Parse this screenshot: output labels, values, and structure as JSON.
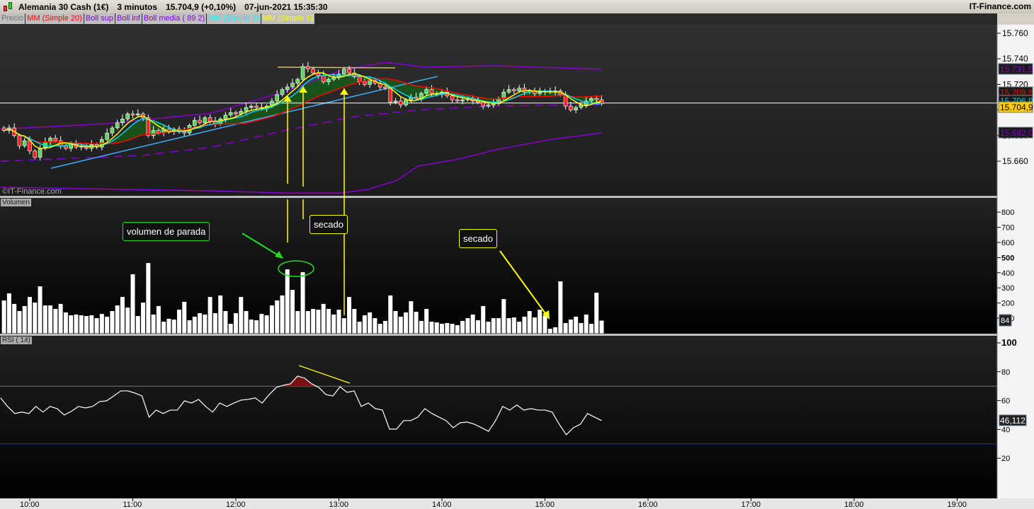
{
  "header": {
    "instrument": "Alemania 30 Cash (1€)",
    "timeframe": "3 minutos",
    "last": "15.704,9 (+0,10%)",
    "datetime": "07-jun-2021 15:35:30",
    "brand": "IT-Finance.com"
  },
  "legend": [
    {
      "label": "Precio",
      "color": "#777777"
    },
    {
      "label": "MM (Simple 20)",
      "color": "#ff0000"
    },
    {
      "label": "Boll sup",
      "color": "#8a00d4"
    },
    {
      "label": "Boll inf",
      "color": "#8a00d4"
    },
    {
      "label": "Boll media ( 89 2)",
      "color": "#8a00d4"
    },
    {
      "label": "MM (Simple 7)",
      "color": "#00ffff"
    },
    {
      "label": "MM (Simple 5)",
      "color": "#ffff00"
    }
  ],
  "watermark": "©IT-Finance.com",
  "panes": {
    "volume": "Volumen",
    "rsi": "RSI ( 14)"
  },
  "annotations": {
    "stop_volume": "volumen de parada",
    "dry1": "secado",
    "dry2": "secado"
  },
  "price_labels": {
    "boll_sup": "15.731,5",
    "ma20": "15.709,8",
    "ma7": "15.706,9",
    "last": "15.704,9",
    "boll_inf": "15.682,0"
  },
  "volume_label": "84",
  "rsi_label": "46,112",
  "chart_data": [
    {
      "type": "candlestick",
      "title": "Alemania 30 Cash (1€) 3 minutos",
      "first_bar": "09:45",
      "bar_minutes": 3,
      "yticks": [
        "15.760",
        "15.740",
        "15.720",
        "15.700",
        "15.680",
        "15.660"
      ],
      "ytick_values": [
        15760,
        15740,
        15720,
        15700,
        15680,
        15660
      ],
      "ylim": [
        15633,
        15775
      ],
      "xticks": [
        "10:00",
        "11:00",
        "12:00",
        "13:00",
        "14:00",
        "15:00",
        "16:00",
        "17:00",
        "18:00",
        "19:00"
      ],
      "closes": [
        15684,
        15686,
        15680,
        15672,
        15676,
        15668,
        15663,
        15670,
        15675,
        15678,
        15676,
        15672,
        15670,
        15673,
        15671,
        15672,
        15670,
        15673,
        15671,
        15677,
        15682,
        15686,
        15690,
        15693,
        15697,
        15696,
        15697,
        15694,
        15680,
        15684,
        15682,
        15685,
        15683,
        15685,
        15683,
        15682,
        15688,
        15692,
        15690,
        15694,
        15691,
        15689,
        15693,
        15696,
        15698,
        15697,
        15699,
        15702,
        15703,
        15702,
        15701,
        15703,
        15707,
        15712,
        15716,
        15718,
        15721,
        15724,
        15734,
        15732,
        15729,
        15727,
        15722,
        15724,
        15726,
        15728,
        15732,
        15729,
        15726,
        15722,
        15720,
        15723,
        15721,
        15718,
        15717,
        15706,
        15707,
        15704,
        15708,
        15710,
        15709,
        15713,
        15716,
        15713,
        15712,
        15714,
        15711,
        15708,
        15707,
        15708,
        15709,
        15707,
        15706,
        15703,
        15704,
        15705,
        15709,
        15714,
        15716,
        15715,
        15717,
        15714,
        15715,
        15713,
        15714,
        15715,
        15714,
        15715,
        15712,
        15703,
        15700,
        15702,
        15704,
        15707,
        15709,
        15708,
        15704.9
      ],
      "boll_sup": [
        [
          "09:43",
          15684.9
        ],
        [
          "10:44",
          15689.3
        ],
        [
          "11:46",
          15697.6
        ],
        [
          "12:28",
          15714.1
        ],
        [
          "13:01",
          15730.7
        ],
        [
          "13:27",
          15737.3
        ],
        [
          "13:50",
          15733.5
        ],
        [
          "14:31",
          15734.6
        ],
        [
          "15:33",
          15731.8
        ]
      ],
      "boll_inf": [
        [
          "09:43",
          15639.6
        ],
        [
          "11:46",
          15636.8
        ],
        [
          "12:28",
          15635.1
        ],
        [
          "13:01",
          15635.1
        ],
        [
          "13:17",
          15637.9
        ],
        [
          "13:34",
          15645.1
        ],
        [
          "13:46",
          15656.1
        ],
        [
          "14:10",
          15661.7
        ],
        [
          "14:31",
          15668.8
        ],
        [
          "15:04",
          15677.1
        ],
        [
          "15:33",
          15682.0
        ]
      ],
      "boll_media": [
        [
          "09:43",
          15660
        ],
        [
          "11:05",
          15664.4
        ],
        [
          "11:46",
          15671
        ],
        [
          "12:28",
          15683.8
        ],
        [
          "13:09",
          15694.8
        ],
        [
          "13:50",
          15700.3
        ],
        [
          "14:31",
          15703.1
        ],
        [
          "15:33",
          15704.2
        ]
      ],
      "current_price": 15704.9
    },
    {
      "type": "bar",
      "title": "Volumen",
      "yticks": [
        "800",
        "700",
        "600",
        "500",
        "400",
        "300",
        "200",
        "100"
      ],
      "ylim": [
        0,
        880
      ],
      "values": [
        217,
        264,
        194,
        147,
        180,
        240,
        203,
        310,
        184,
        184,
        161,
        194,
        138,
        119,
        124,
        119,
        114,
        119,
        100,
        128,
        110,
        147,
        184,
        240,
        170,
        390,
        114,
        203,
        464,
        124,
        180,
        77,
        96,
        91,
        156,
        208,
        86,
        110,
        133,
        124,
        240,
        133,
        250,
        147,
        63,
        133,
        240,
        147,
        91,
        86,
        128,
        119,
        184,
        217,
        250,
        422,
        287,
        147,
        404,
        147,
        161,
        156,
        194,
        161,
        124,
        156,
        100,
        240,
        161,
        77,
        119,
        138,
        100,
        63,
        82,
        250,
        147,
        110,
        138,
        212,
        142,
        82,
        161,
        77,
        72,
        63,
        68,
        63,
        54,
        82,
        100,
        124,
        86,
        180,
        77,
        100,
        100,
        226,
        100,
        105,
        77,
        110,
        147,
        105,
        156,
        119,
        30,
        40,
        343,
        68,
        91,
        110,
        68,
        124,
        63,
        268,
        84
      ]
    },
    {
      "type": "line",
      "title": "RSI ( 14)",
      "yticks": [
        "100",
        "80",
        "60",
        "40",
        "20"
      ],
      "ylim": [
        0,
        100
      ],
      "levels": [
        70,
        30
      ],
      "start": "09:43",
      "end": "15:33",
      "values": [
        61.8,
        55.9,
        51,
        52,
        51,
        55.9,
        52,
        55.9,
        54.4,
        50,
        52.5,
        55.9,
        54.9,
        55.9,
        59.3,
        59.8,
        63.2,
        66.7,
        66.7,
        65.2,
        63.2,
        48.5,
        53.4,
        51,
        53.4,
        53.4,
        59.8,
        58.3,
        60.8,
        55.9,
        52,
        58.3,
        55.9,
        58.3,
        60.3,
        60.8,
        61.8,
        58.3,
        64.2,
        69.1,
        70.6,
        71.6,
        77,
        75.5,
        71.6,
        69.1,
        64.2,
        63.2,
        69.6,
        65.7,
        66.7,
        55.9,
        58.3,
        54.4,
        53.4,
        40.2,
        40.2,
        46.1,
        46.1,
        48.5,
        54.4,
        51,
        48.5,
        46.1,
        41.2,
        44.6,
        45.1,
        43.6,
        41.2,
        38.7,
        46.1,
        55.9,
        53.4,
        56.9,
        53.4,
        54.4,
        53.4,
        53.4,
        52,
        43.6,
        36.3,
        41.2,
        43.6,
        51,
        48.5,
        46.1
      ]
    }
  ],
  "colors": {
    "bull": "#5cd65c",
    "bear": "#ff2020",
    "ma20": "#ff0000",
    "ma7": "#00d8e8",
    "ma5": "#ffff00",
    "boll": "#8a00d4",
    "trend": "#3fa9f5",
    "drawing": "#ffff00",
    "green_mark": "#22dd22",
    "rsi_upper": "#777777",
    "rsi_lower": "#2020ff"
  }
}
